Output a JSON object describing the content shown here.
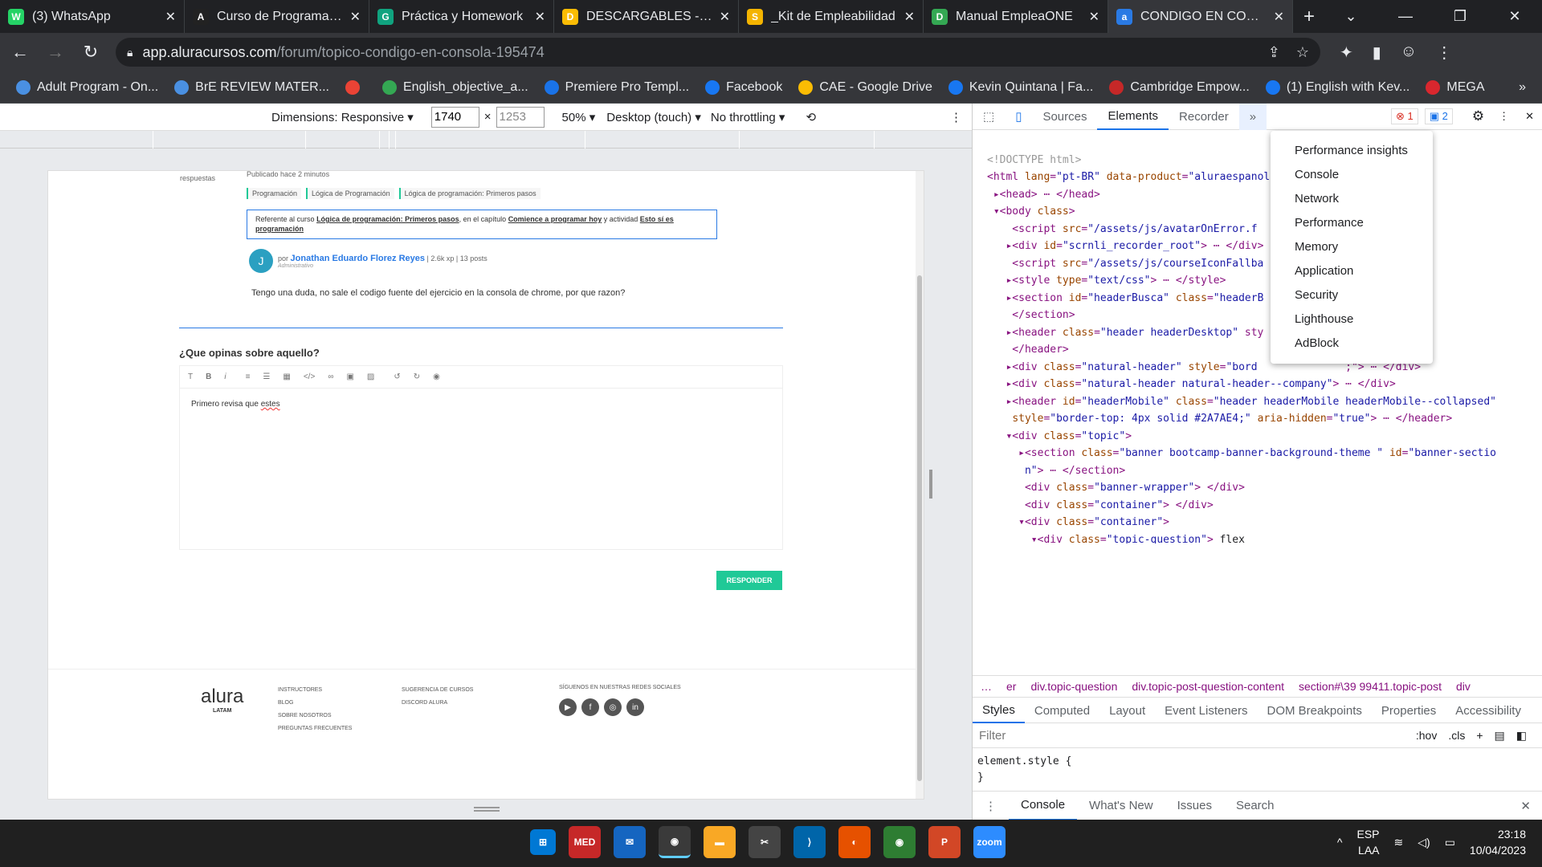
{
  "tabs": [
    {
      "title": "(3) WhatsApp",
      "color": "#25d366",
      "glyph": "W"
    },
    {
      "title": "Curso de Programació",
      "color": "#222222",
      "glyph": "A"
    },
    {
      "title": "Práctica y Homework",
      "color": "#10a37f",
      "glyph": "G"
    },
    {
      "title": "DESCARGABLES - Goo",
      "color": "#fbbc04",
      "glyph": "D"
    },
    {
      "title": "_Kit de Empleabilidad",
      "color": "#f4b400",
      "glyph": "S"
    },
    {
      "title": "Manual EmpleaONE",
      "color": "#34a853",
      "glyph": "D"
    },
    {
      "title": "CONDIGO EN CONSO",
      "color": "#2a7ae4",
      "glyph": "a"
    }
  ],
  "address": {
    "host": "app.aluracursos.com",
    "path": "/forum/topico-condigo-en-consola-195474"
  },
  "bookmarks": [
    {
      "label": "Adult Program - On...",
      "color": "#4a90e2"
    },
    {
      "label": "BrE REVIEW MATER...",
      "color": "#4a90e2"
    },
    {
      "label": "",
      "color": "#ea4335"
    },
    {
      "label": "English_objective_a...",
      "color": "#34a853"
    },
    {
      "label": "Premiere Pro Templ...",
      "color": "#1a73e8"
    },
    {
      "label": "Facebook",
      "color": "#1877f2"
    },
    {
      "label": "CAE - Google Drive",
      "color": "#fbbc04"
    },
    {
      "label": "Kevin Quintana | Fa...",
      "color": "#1877f2"
    },
    {
      "label": "Cambridge Empow...",
      "color": "#c62828"
    },
    {
      "label": "(1) English with Kev...",
      "color": "#1877f2"
    },
    {
      "label": "MEGA",
      "color": "#d9272e"
    }
  ],
  "devicebar": {
    "dimensions": "Dimensions: Responsive",
    "width": "1740",
    "height": "1253",
    "zoom": "50%",
    "device": "Desktop (touch)",
    "throttle": "No throttling"
  },
  "page": {
    "respuestas": "respuestas",
    "published": "Publicado hace 2 minutos",
    "chips": [
      "Programación",
      "Lógica de Programación",
      "Lógica de programación: Primeros pasos"
    ],
    "ref_prefix": "Referente al curso",
    "ref_course": "Lógica de programación: Primeros pasos",
    "ref_mid": ", en el capítulo",
    "ref_chapter": "Comience a programar hoy",
    "ref_act": "y actividad",
    "ref_activity": "Esto sí es programación",
    "by": "por",
    "author": "Jonathan Eduardo Florez Reyes",
    "author_meta": "| 2.6k xp | 13 posts",
    "author_role": "Administrativo",
    "avatar_letter": "J",
    "question": "Tengo una duda, no sale el codigo fuente del ejercicio en la consola de chrome, por que razon?",
    "opinion_title": "¿Que opinas sobre aquello?",
    "editor_text_a": "Primero revisa que ",
    "editor_text_b": "estes",
    "respond": "RESPONDER",
    "logo": "alura",
    "logo_sub": "LATAM",
    "footer_col1": [
      "INSTRUCTORES",
      "BLOG",
      "SOBRE NOSOTROS",
      "PREGUNTAS FRECUENTES"
    ],
    "footer_col2": [
      "SUGERENCIA DE CURSOS",
      "DISCORD ALURA"
    ],
    "social_title": "SÍGUENOS EN NUESTRAS REDES SOCIALES"
  },
  "devtools": {
    "tabs": [
      "Sources",
      "Elements",
      "Recorder"
    ],
    "errors": "1",
    "messages": "2",
    "menu": [
      "Performance insights",
      "Console",
      "Network",
      "Performance",
      "Memory",
      "Application",
      "Security",
      "Lighthouse",
      "AdBlock"
    ],
    "breadcrumbs": [
      "er",
      "div.topic-question",
      "div.topic-post-question-content",
      "section#\\39 99411.topic-post",
      "div"
    ],
    "subtabs": [
      "Styles",
      "Computed",
      "Layout",
      "Event Listeners",
      "DOM Breakpoints",
      "Properties",
      "Accessibility"
    ],
    "filter_placeholder": "Filter",
    "hov": ":hov",
    "cls": ".cls",
    "element_style": "element.style {",
    "close_brace": "}",
    "drawer": [
      "Console",
      "What's New",
      "Issues",
      "Search"
    ]
  },
  "tray": {
    "lang1": "ESP",
    "lang2": "LAA",
    "time": "23:18",
    "date": "10/04/2023"
  }
}
